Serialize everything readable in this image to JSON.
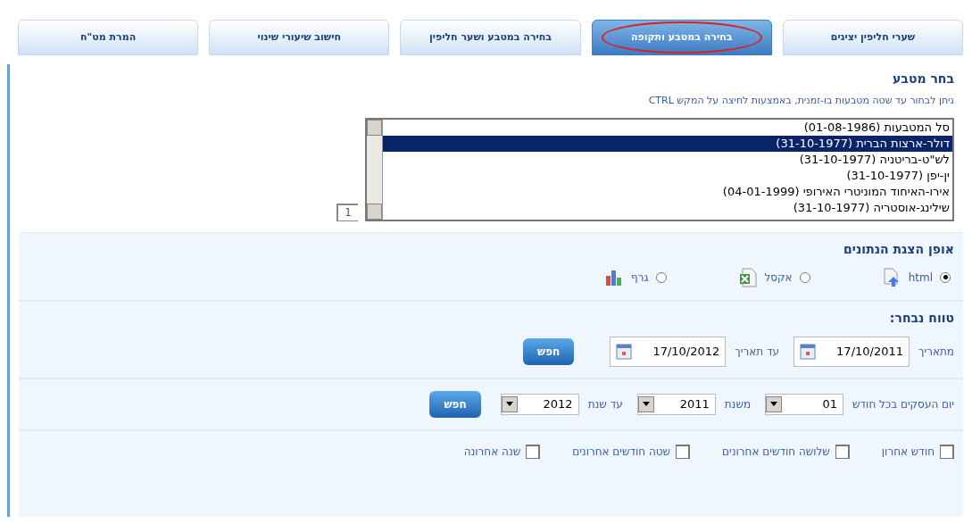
{
  "tabs": [
    {
      "label": "שערי חליפין יציגים",
      "selected": false,
      "circled": false
    },
    {
      "label": "בחירה במטבע ותקופה",
      "selected": true,
      "circled": true
    },
    {
      "label": "בחירה במטבע ושער חליפין",
      "selected": false,
      "circled": false
    },
    {
      "label": "חישוב שיעורי שינוי",
      "selected": false,
      "circled": false
    },
    {
      "label": "המרת מט\"ח",
      "selected": false,
      "circled": false
    }
  ],
  "currency_section": {
    "title": "בחר מטבע",
    "hint": "ניתן לבחור עד שטה מטבעות בו-זמנית, באמצעות לחיצה על המקש CTRL",
    "count": "1",
    "options": [
      {
        "label": "סל המטבעות (01-08-1986)",
        "selected": false
      },
      {
        "label": "דולר-ארצות הברית (31-10-1977)",
        "selected": true
      },
      {
        "label": "לש\"ט-בריטניה (31-10-1977)",
        "selected": false
      },
      {
        "label": "ין-יפן (31-10-1977)",
        "selected": false
      },
      {
        "label": "אירו-האיחוד המוניטרי האירופי (04-01-1999)",
        "selected": false
      },
      {
        "label": "שילינג-אוסטריה (31-10-1977)",
        "selected": false
      }
    ]
  },
  "format_section": {
    "title": "אופן הצגת הנתונים",
    "options": [
      {
        "kind": "html",
        "label": "html",
        "selected": true
      },
      {
        "kind": "excel",
        "label": "אקסל",
        "selected": false
      },
      {
        "kind": "chart",
        "label": "גרף",
        "selected": false
      }
    ]
  },
  "range_section": {
    "title": "טווח נבחר:",
    "from_label": "מתאריך",
    "from_value": "17/10/2011",
    "to_label": "עד תאריך",
    "to_value": "17/10/2012",
    "search_button": "חפש"
  },
  "monthly_section": {
    "day_label": "יום העסקים בכל חודש",
    "day_value": "01",
    "from_label": "משנת",
    "from_value": "2011",
    "to_label": "עד שנת",
    "to_value": "2012",
    "search_button": "חפש"
  },
  "quick_ranges": [
    {
      "label": "חודש אחרון",
      "checked": false
    },
    {
      "label": "שלושה חודשים אחרונים",
      "checked": false
    },
    {
      "label": "שטה חודשים אחרונים",
      "checked": false
    },
    {
      "label": "שנה אחרונה",
      "checked": false
    }
  ]
}
